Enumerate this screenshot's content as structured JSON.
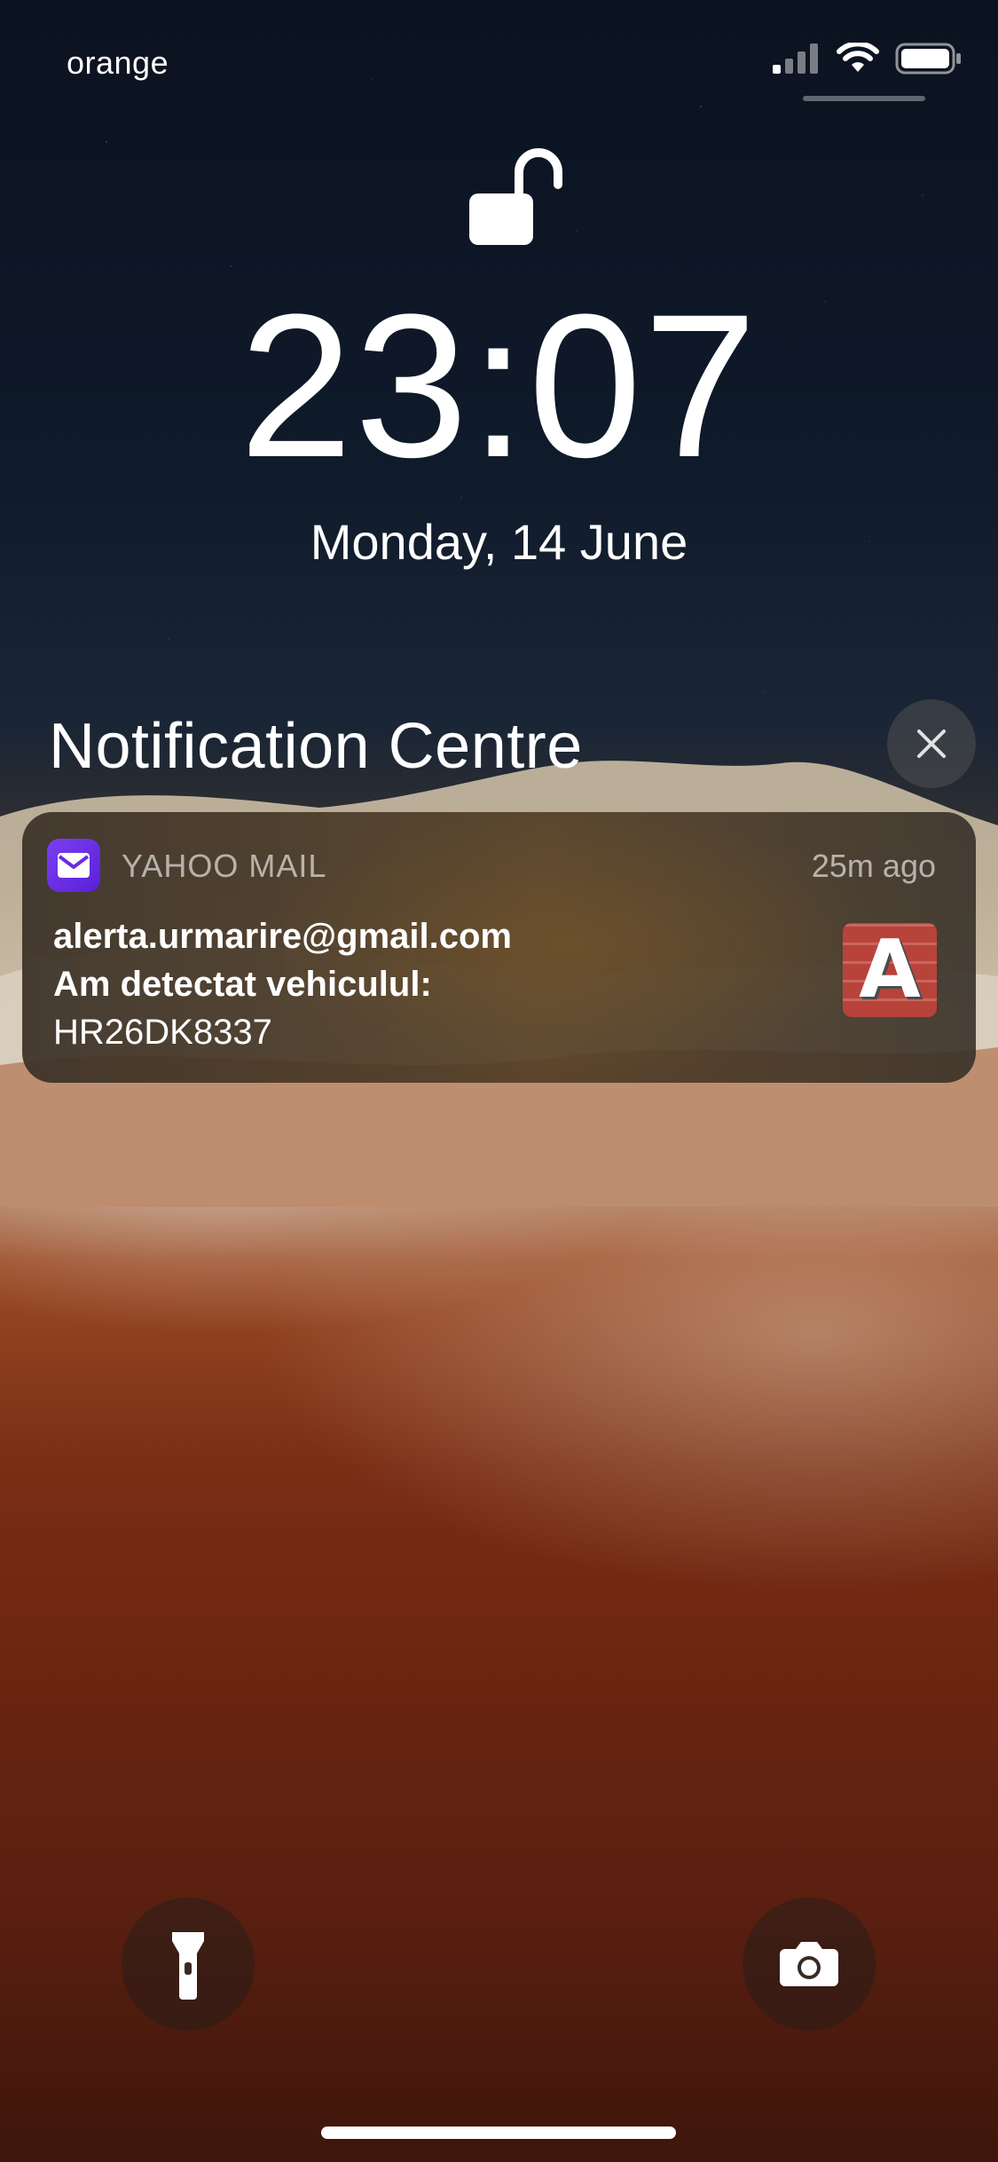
{
  "status_bar": {
    "carrier": "orange",
    "icons": [
      "cellular-signal-icon",
      "wifi-icon",
      "battery-icon"
    ]
  },
  "lock_screen": {
    "lock_icon": "unlocked-padlock-icon",
    "time": "23:07",
    "date": "Monday, 14 June"
  },
  "notification_centre": {
    "title": "Notification Centre",
    "close_icon": "close-icon"
  },
  "notification": {
    "app_name": "YAHOO MAIL",
    "time_ago": "25m ago",
    "sender": "alerta.urmarire@gmail.com",
    "subject": "Am detectat vehiculul:",
    "body": "HR26DK8337",
    "thumbnail_letter": "A"
  },
  "quick_actions": {
    "left": "flashlight-icon",
    "right": "camera-icon"
  }
}
